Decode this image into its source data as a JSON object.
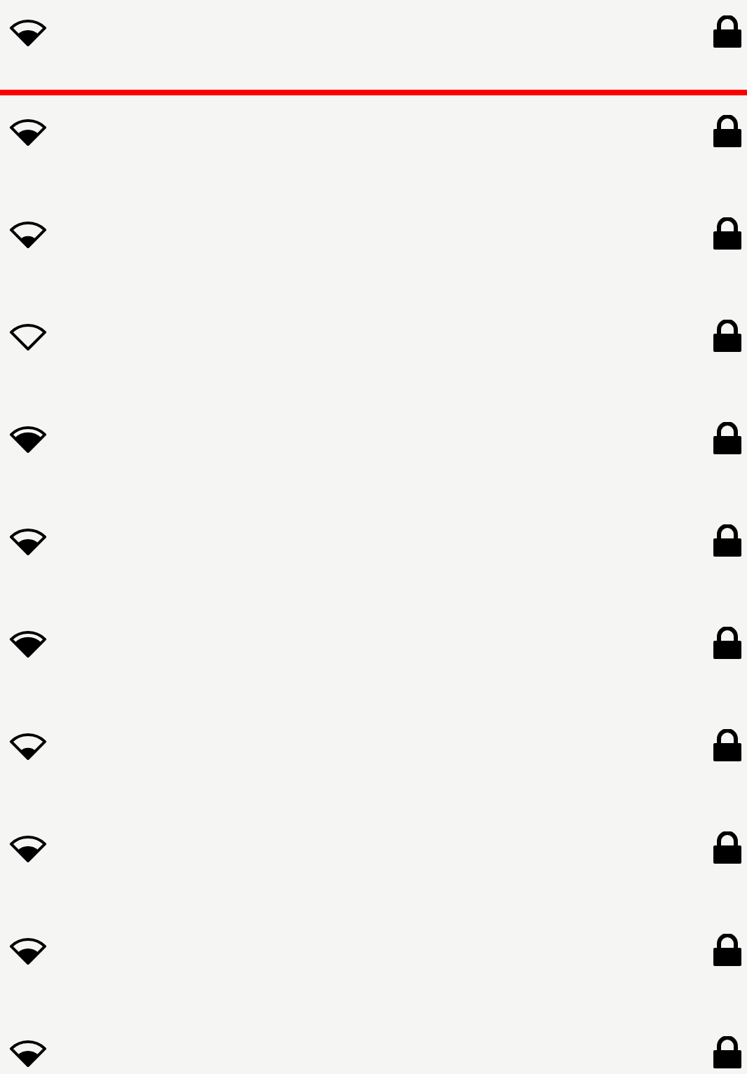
{
  "networks": [
    {
      "kind": "medium",
      "secured": true
    },
    {
      "kind": "medium",
      "secured": true
    },
    {
      "kind": "low",
      "secured": true
    },
    {
      "kind": "none",
      "secured": true
    },
    {
      "kind": "high",
      "secured": true
    },
    {
      "kind": "medium",
      "secured": true
    },
    {
      "kind": "high",
      "secured": true
    },
    {
      "kind": "low",
      "secured": true
    },
    {
      "kind": "medium",
      "secured": true
    },
    {
      "kind": "medium",
      "secured": true
    },
    {
      "kind": "medium",
      "secured": true
    }
  ]
}
